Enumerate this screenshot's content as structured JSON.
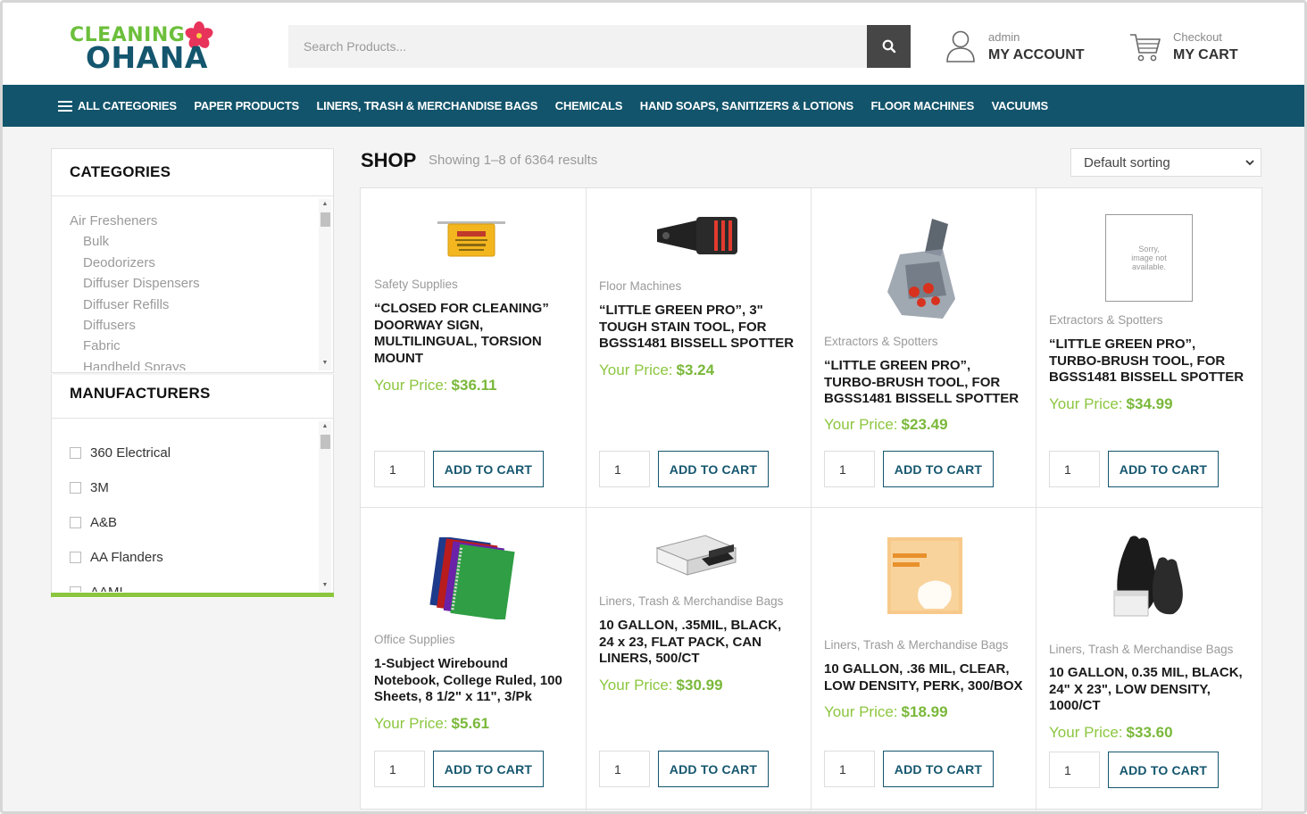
{
  "header": {
    "logo_line1": "CLEANING",
    "logo_line2": "OHANA",
    "search_placeholder": "Search Products...",
    "account_small": "admin",
    "account_big": "MY ACCOUNT",
    "cart_small": "Checkout",
    "cart_big": "MY CART"
  },
  "nav": {
    "items": [
      "ALL CATEGORIES",
      "PAPER PRODUCTS",
      "LINERS, TRASH & MERCHANDISE BAGS",
      "CHEMICALS",
      "HAND SOAPS, SANITIZERS & LOTIONS",
      "FLOOR MACHINES",
      "VACUUMS"
    ]
  },
  "sidebar": {
    "categories_title": "CATEGORIES",
    "categories": [
      "Air Fresheners",
      "Bulk",
      "Deodorizers",
      "Diffuser Dispensers",
      "Diffuser Refills",
      "Diffusers",
      "Fabric",
      "Handheld Sprays"
    ],
    "manufacturers_title": "MANUFACTURERS",
    "manufacturers": [
      "360 Electrical",
      "3M",
      "A&B",
      "AA Flanders",
      "AAMI"
    ]
  },
  "shop": {
    "title": "SHOP",
    "showing": "Showing 1–8 of 6364 results",
    "sort_value": "Default sorting",
    "price_label": "Your Price:",
    "add_label": "ADD TO CART",
    "qty_default": "1",
    "no_image_text": "Sorry, image not available.",
    "products": [
      {
        "category": "Safety Supplies",
        "name": "“CLOSED FOR CLEANING” DOORWAY SIGN, MULTILINGUAL, TORSION MOUNT",
        "price": "$36.11",
        "image_icon": "closed-sign-icon"
      },
      {
        "category": "Floor Machines",
        "name": "“LITTLE GREEN PRO”, 3\" TOUGH STAIN TOOL, FOR BGSS1481 BISSELL SPOTTER",
        "price": "$3.24",
        "image_icon": "stain-tool-icon"
      },
      {
        "category": "Extractors & Spotters",
        "name": "“LITTLE GREEN PRO”, TURBO-BRUSH TOOL, FOR BGSS1481 BISSELL SPOTTER",
        "price": "$23.49",
        "image_icon": "turbo-brush-icon"
      },
      {
        "category": "Extractors & Spotters",
        "name": "“LITTLE GREEN PRO”, TURBO-BRUSH TOOL, FOR BGSS1481 BISSELL SPOTTER",
        "price": "$34.99",
        "image_icon": "no-image-placeholder"
      },
      {
        "category": "Office Supplies",
        "name": "1-Subject Wirebound Notebook, College Ruled, 100 Sheets, 8 1/2\" x 11\", 3/Pk",
        "price": "$5.61",
        "image_icon": "notebooks-icon"
      },
      {
        "category": "Liners, Trash & Merchandise Bags",
        "name": "10 GALLON, .35MIL, BLACK, 24 x 23, FLAT PACK, CAN LINERS, 500/CT",
        "price": "$30.99",
        "image_icon": "can-liners-box-icon"
      },
      {
        "category": "Liners, Trash & Merchandise Bags",
        "name": "10 GALLON, .36 MIL, CLEAR, LOW DENSITY, PERK, 300/BOX",
        "price": "$18.99",
        "image_icon": "trash-bag-box-icon"
      },
      {
        "category": "Liners, Trash & Merchandise Bags",
        "name": "10 GALLON, 0.35 MIL, BLACK, 24\" X 23\", LOW DENSITY, 1000/CT",
        "price": "$33.60",
        "image_icon": "black-trash-bags-icon"
      }
    ]
  },
  "colors": {
    "nav_bg": "#12546b",
    "brand_green": "#8cc63f",
    "brand_blue": "#14566e",
    "search_btn": "#464646"
  }
}
